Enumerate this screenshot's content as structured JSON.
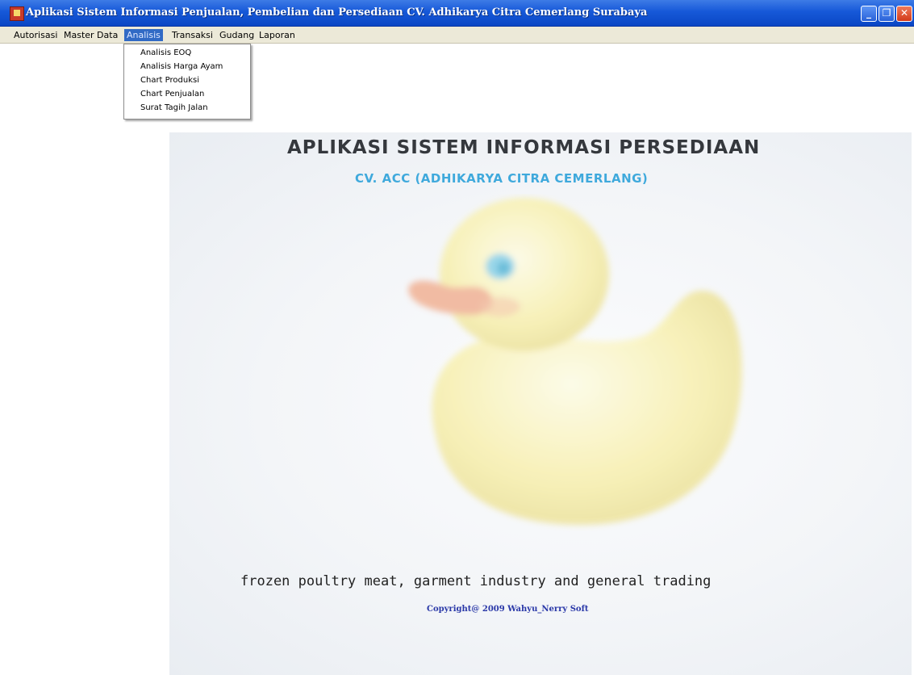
{
  "window": {
    "title": "Aplikasi Sistem Informasi Penjualan, Pembelian dan Persediaan CV. Adhikarya Citra Cemerlang Surabaya",
    "controls": {
      "minimize": "_",
      "maximize": "❐",
      "close": "✕"
    }
  },
  "menubar": {
    "items": [
      {
        "label": "Autorisasi"
      },
      {
        "label": "Master Data"
      },
      {
        "label": "Analisis",
        "active": true
      },
      {
        "label": "Transaksi"
      },
      {
        "label": "Gudang"
      },
      {
        "label": "Laporan"
      }
    ]
  },
  "dropdown": {
    "items": [
      {
        "label": "Analisis EOQ"
      },
      {
        "label": "Analisis Harga Ayam"
      },
      {
        "label": "Chart Produksi"
      },
      {
        "label": "Chart Penjualan"
      },
      {
        "label": "Surat Tagih Jalan"
      }
    ]
  },
  "splash": {
    "heading": "APLIKASI SISTEM INFORMASI PERSEDIAAN",
    "subheading": "CV. ACC (ADHIKARYA CITRA CEMERLANG)",
    "tagline": "frozen poultry meat, garment industry and general trading",
    "copyright": "Copyright@ 2009 Wahyu_Nerry Soft",
    "image": "rubber-duck"
  },
  "colors": {
    "titlebar": "#1658d8",
    "menu_active": "#316ac5",
    "heading": "#35383d",
    "subheading": "#3fa9dc",
    "copyright": "#2a38a8"
  }
}
